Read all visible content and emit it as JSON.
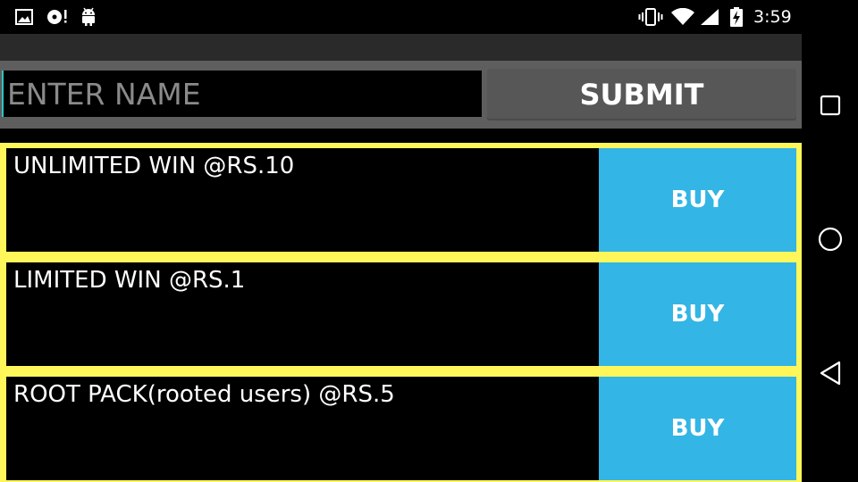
{
  "status_bar": {
    "time": "3:59",
    "icons": [
      "image-icon",
      "media-notification-icon",
      "android-icon",
      "vibrate-icon",
      "wifi-icon",
      "signal-icon",
      "battery-charging-icon"
    ]
  },
  "form": {
    "name_placeholder": "ENTER NAME",
    "name_value": "",
    "submit_label": "SUBMIT"
  },
  "products": [
    {
      "label": "UNLIMITED WIN @RS.10",
      "button_label": "BUY"
    },
    {
      "label": "LIMITED WIN @RS.1",
      "button_label": "BUY"
    },
    {
      "label": "ROOT PACK(rooted users) @RS.5",
      "button_label": "BUY"
    }
  ],
  "nav_bar": {
    "buttons": [
      "recents-icon",
      "home-icon",
      "back-icon"
    ]
  },
  "colors": {
    "item_border": "#fff65a",
    "buy_button": "#33b5e5",
    "submit_button": "#575757",
    "input_row_bg": "#5e5e5e"
  }
}
